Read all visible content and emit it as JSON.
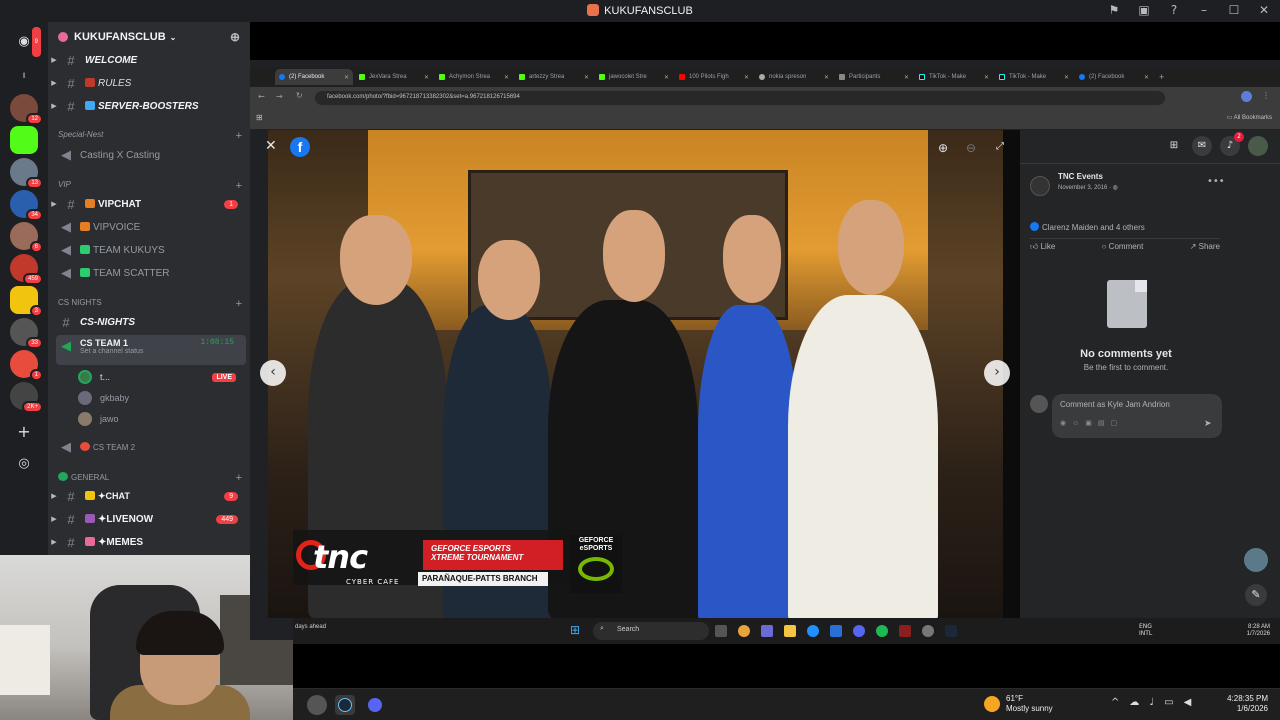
{
  "window": {
    "title": "KUKUFANSCLUB"
  },
  "guild_badges": [
    "9",
    "12",
    "13",
    "34",
    "6",
    "459",
    "3",
    "33",
    "1",
    "2K+"
  ],
  "server": {
    "name": "KUKUFANSCLUB",
    "channels_top": [
      {
        "name": "WELCOME"
      },
      {
        "name": "RULES"
      },
      {
        "name": "SERVER-BOOSTERS"
      }
    ],
    "special_category": "Special-Nest",
    "special_channels": [
      {
        "name": "Casting X Casting"
      }
    ],
    "vip_category": "VIP",
    "vip_channels": [
      {
        "name": "VIPCHAT",
        "badge": "1"
      },
      {
        "name": "VIPVOICE"
      },
      {
        "name": "TEAM KUKUYS"
      },
      {
        "name": "TEAM SCATTER"
      }
    ],
    "cs_category": "CS NIGHTS",
    "cs_channels": [
      {
        "name": "CS-NIGHTS"
      },
      {
        "name": "CS TEAM 1",
        "timer": "1:08:15",
        "status": "Set a channel status"
      },
      {
        "name": "CS TEAM 2"
      }
    ],
    "voice_users": [
      {
        "name": "t...",
        "live": "LIVE"
      },
      {
        "name": "gkbaby"
      },
      {
        "name": "jawo"
      }
    ],
    "general_category": "GENERAL",
    "general_channels": [
      {
        "name": "✦CHAT",
        "badge": "9"
      },
      {
        "name": "✦LIVENOW",
        "badge": "449"
      },
      {
        "name": "✦MEMES"
      }
    ]
  },
  "browser": {
    "tabs": [
      "(2) Facebook",
      "JexVara Strea",
      "Achymon Strea",
      "artezzy Strea",
      "jawocolet Stre",
      "100 Pilots Figh",
      "nokia spreson",
      "Participants",
      "TikTok - Make",
      "TikTok - Make",
      "(2) Facebook"
    ],
    "url": "facebook.com/photo/?fbid=967218713382302&set=a.967218126715694",
    "all_bookmarks": "All Bookmarks"
  },
  "photo": {
    "brand": "tnc",
    "brand_sub": "CYBER CAFE",
    "event_line1": "GEFORCE ESPORTS",
    "event_line2": "XTREME TOURNAMENT",
    "branch": "PARAÑAQUE-PATTS BRANCH",
    "gf_badge_1": "GEFORCE",
    "gf_badge_2": "eSPORTS"
  },
  "fb_post": {
    "page": "TNC Events",
    "date": "November 3, 2016 · ",
    "reactions": "Clarenz Maiden and 4 others",
    "actions": [
      "Like",
      "Comment",
      "Share"
    ],
    "no_comments_title": "No comments yet",
    "no_comments_sub": "Be the first to comment.",
    "comment_placeholder": "Comment as Kyle Jam Andrion",
    "notif_count": "2"
  },
  "inner_taskbar": {
    "days_ahead": "days ahead",
    "search": "Search",
    "lang_1": "ENG",
    "lang_2": "INTL",
    "time": "8:28 AM",
    "date": "1/7/2026"
  },
  "taskbar": {
    "weather_temp": "61°F",
    "weather_desc": "Mostly sunny",
    "time": "4:28:35 PM",
    "date": "1/6/2026"
  }
}
